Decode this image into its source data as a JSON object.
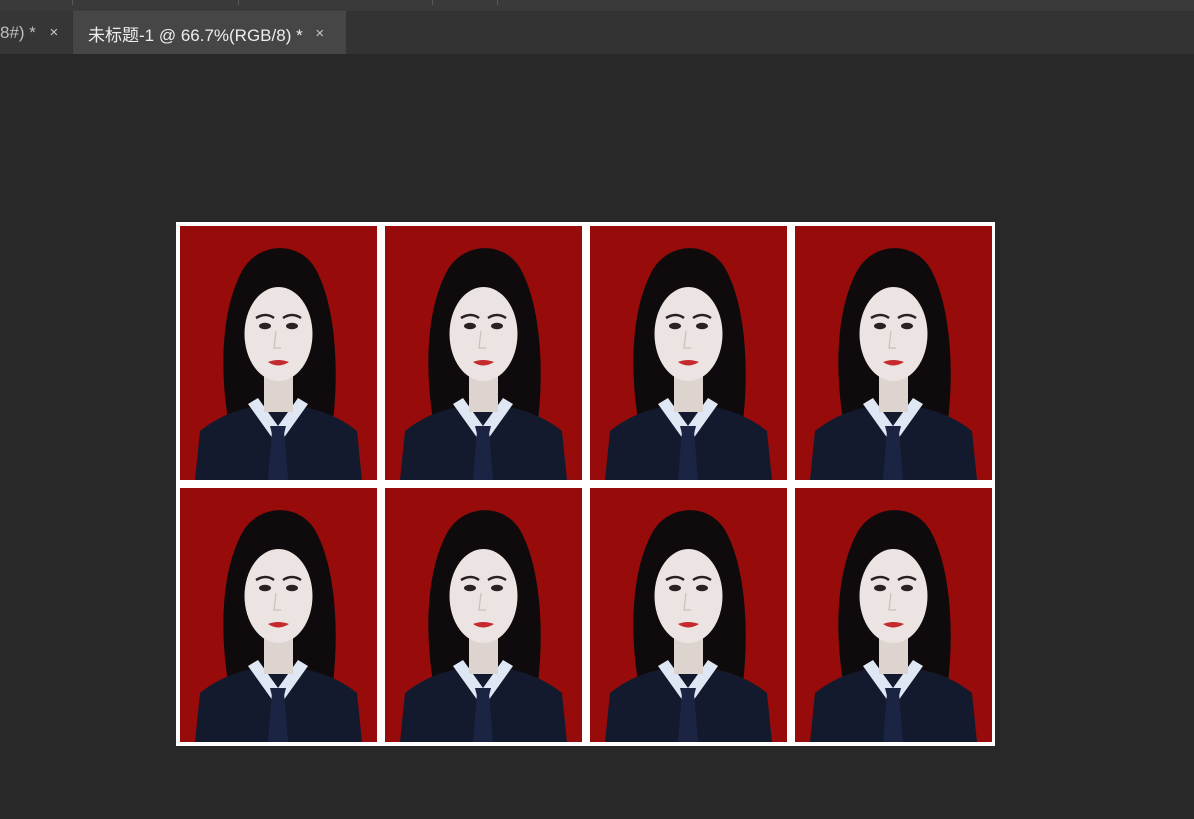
{
  "tabs": [
    {
      "label": "8#) *",
      "active": false
    },
    {
      "label": "未标题-1 @ 66.7%(RGB/8) *",
      "active": true
    }
  ],
  "close_glyph": "×",
  "document": {
    "rows": 2,
    "columns": 4,
    "photo_count": 8,
    "photo_background_color": "#970c0b",
    "sheet_color": "#ffffff"
  },
  "colors": {
    "workspace": "#282828",
    "tabbar": "#333333",
    "active_tab": "#464646"
  }
}
